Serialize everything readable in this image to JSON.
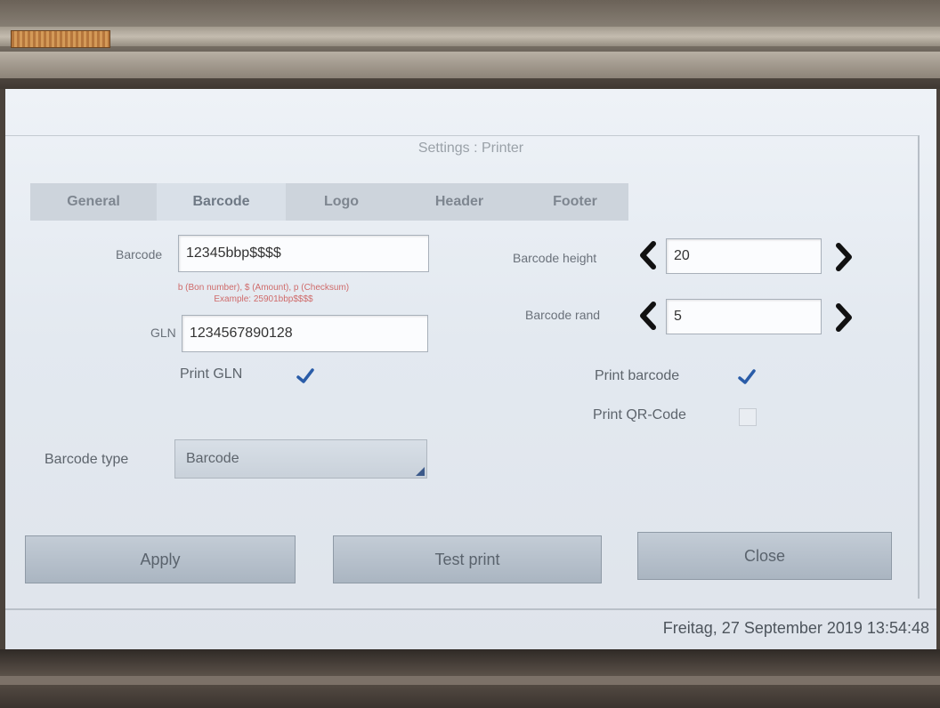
{
  "window": {
    "title": "Settings : Printer"
  },
  "tabs": [
    {
      "label": "General",
      "active": false
    },
    {
      "label": "Barcode",
      "active": true
    },
    {
      "label": "Logo",
      "active": false
    },
    {
      "label": "Header",
      "active": false
    },
    {
      "label": "Footer",
      "active": false
    }
  ],
  "barcode": {
    "label": "Barcode",
    "value": "12345bbp$$$$",
    "hint_line1": "b (Bon number), $ (Amount), p (Checksum)",
    "hint_line2": "Example: 25901bbp$$$$"
  },
  "gln": {
    "label": "GLN",
    "value": "1234567890128",
    "print_label": "Print GLN",
    "print_checked": true
  },
  "barcode_height": {
    "label": "Barcode height",
    "value": "20"
  },
  "barcode_rand": {
    "label": "Barcode rand",
    "value": "5"
  },
  "print_barcode": {
    "label": "Print barcode",
    "checked": true
  },
  "print_qrcode": {
    "label": "Print QR-Code",
    "checked": false
  },
  "barcode_type": {
    "label": "Barcode type",
    "selected": "Barcode"
  },
  "buttons": {
    "apply": "Apply",
    "test_print": "Test print",
    "close": "Close"
  },
  "status": {
    "datetime": "Freitag, 27 September 2019 13:54:48"
  },
  "icons": {
    "check": "checkmark-icon",
    "decrease": "chevron-left-icon",
    "increase": "chevron-right-icon",
    "dropdown": "dropdown-corner-icon"
  },
  "colors": {
    "checkmark": "#2a5ca8",
    "hint_text": "#cf6b6b"
  }
}
